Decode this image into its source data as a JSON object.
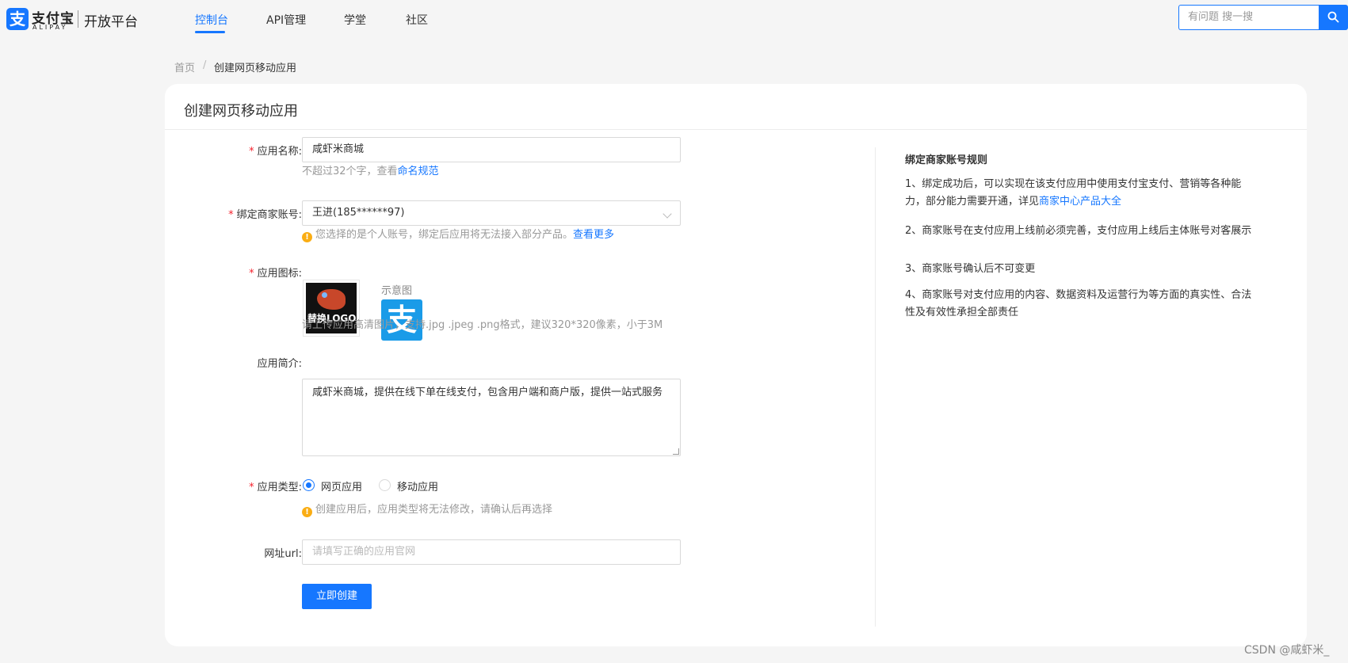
{
  "header": {
    "logo_mark": "支",
    "logo_cn": "支付宝",
    "logo_en": "ALIPAY",
    "platform": "开放平台",
    "nav": [
      "控制台",
      "API管理",
      "学堂",
      "社区"
    ],
    "search_placeholder": "有问题 搜一搜"
  },
  "breadcrumb": {
    "home": "首页",
    "sep": "/",
    "current": "创建网页移动应用"
  },
  "card": {
    "title": "创建网页移动应用"
  },
  "form": {
    "app_name": {
      "label": "应用名称:",
      "value": "咸虾米商城",
      "hint": "不超过32个字，查看",
      "hint_link": "命名规范"
    },
    "merchant": {
      "label": "绑定商家账号:",
      "value": "王进(185******97)",
      "warn": "您选择的是个人账号，绑定后应用将无法接入部分产品。",
      "warn_link": "查看更多"
    },
    "icon": {
      "label": "应用图标:",
      "replace": "替换LOGO",
      "sample_label": "示意图",
      "sample_glyph": "支",
      "hint": "请上传应用高清图片，支持.jpg .jpeg .png格式，建议320*320像素，小于3M"
    },
    "intro": {
      "label": "应用简介:",
      "value": "咸虾米商城，提供在线下单在线支付，包含用户端和商户版，提供一站式服务"
    },
    "type": {
      "label": "应用类型:",
      "options": [
        "网页应用",
        "移动应用"
      ],
      "selected": "网页应用",
      "warn": "创建应用后，应用类型将无法修改，请确认后再选择"
    },
    "url": {
      "label": "网址url:",
      "placeholder": "请填写正确的应用官网"
    },
    "submit": "立即创建"
  },
  "rules": {
    "title": "绑定商家账号规则",
    "items": [
      {
        "text": "1、绑定成功后，可以实现在该支付应用中使用支付宝支付、营销等各种能力，部分能力需要开通，详见",
        "link": "商家中心产品大全"
      },
      {
        "text": "2、商家账号在支付应用上线前必须完善，支付应用上线后主体账号对客展示"
      },
      {
        "text": "3、商家账号确认后不可变更"
      },
      {
        "text": "4、商家账号对支付应用的内容、数据资料及运营行为等方面的真实性、合法性及有效性承担全部责任"
      }
    ]
  },
  "watermark": "CSDN @咸虾米_",
  "colors": {
    "primary": "#1677ff",
    "required": "#f5222d",
    "warning": "#faad14"
  }
}
